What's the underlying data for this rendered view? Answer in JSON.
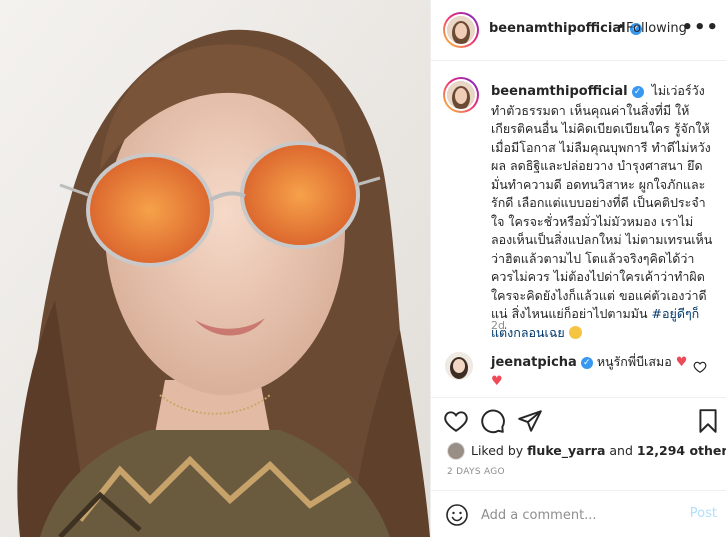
{
  "post": {
    "author": "beenamthipofficial",
    "follow_separator": "•",
    "follow_state": "Following",
    "more_label": "•••",
    "verified_mark": "✓"
  },
  "caption": {
    "author": "beenamthipofficial",
    "text": "ไม่เว่อร์วัง ทำตัวธรรมดา เห็นคุณค่าในสิ่งที่มี ให้เกียรติคนอื่น ไม่คิดเบียดเบียนใคร รู้จักให้เมื่อมีโอกาส ไม่ลืมคุณบุพการี ทำดีไม่หวังผล ลดธิฐิและปล่อยวาง บำรุงศาสนา ยึดมั่นทำความดี อดทนวิสาหะ ผูกใจภักและรักดี เลือกแต่แบบอย่างที่ดี เป็นคติประจำใจ ใครจะชั่วหรือมั่วไม่มัวหมอง เราไม่ลองเห็นเป็นสิ่งแปลกใหม่ ไม่ตามเทรนเห็นว่าฮิตแล้วตามไป โตแล้วจริงๆคิดได้ว่าควรไม่ควร ไม่ต้องไปด่าใครเค้าว่าทำผิด ใครจะคิดยังไงก็แล้วแต่ ขอแค่ตัวเองว่าดีแน่ สิ่งไหนแย่ก็อย่าไปตามมัน",
    "hashtag": "#อยู่ดีๆก็แต่งกลอนเฉย",
    "age": "2d"
  },
  "comment": {
    "author": "jeenatpicha",
    "text": "หนูรักพี่บีเสมอ",
    "heart": "♥",
    "heart2": "♥"
  },
  "likes": {
    "prefix": "Liked by",
    "user": "fluke_yarra",
    "middle": "and",
    "count": "12,294 others"
  },
  "date": "2 DAYS AGO",
  "add_comment": {
    "placeholder": "Add a comment...",
    "post_label": "Post"
  },
  "colors": {
    "verified": "#3897f0",
    "heart": "#ed4956",
    "post_disabled": "#b2dffc",
    "hashtag": "#00376b",
    "muted": "#8e8e8e"
  },
  "icons": [
    "heart-icon",
    "comment-icon",
    "share-icon",
    "bookmark-icon",
    "smile-icon",
    "more-icon",
    "verified-icon"
  ]
}
